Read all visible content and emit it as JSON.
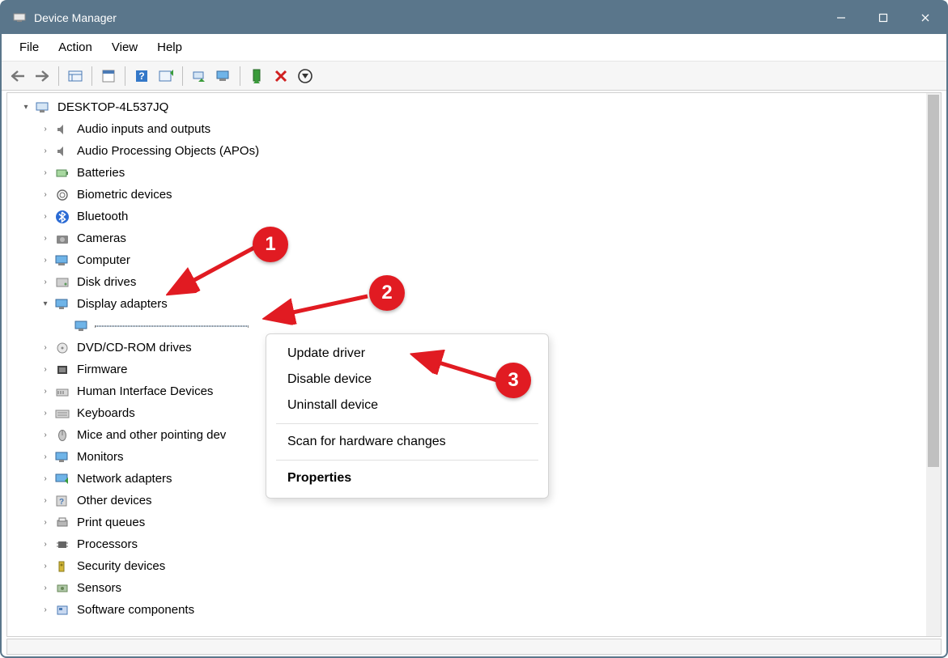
{
  "window": {
    "title": "Device Manager"
  },
  "menubar": [
    "File",
    "Action",
    "View",
    "Help"
  ],
  "toolbar_icons": [
    "back",
    "forward",
    "sep",
    "show-hidden",
    "properties",
    "sep",
    "help",
    "update",
    "sep",
    "scan",
    "monitor",
    "sep",
    "enable",
    "disable",
    "sep",
    "uninstall"
  ],
  "root_node": "DESKTOP-4L537JQ",
  "categories": [
    {
      "label": "Audio inputs and outputs",
      "icon": "audio"
    },
    {
      "label": "Audio Processing Objects (APOs)",
      "icon": "audio"
    },
    {
      "label": "Batteries",
      "icon": "battery"
    },
    {
      "label": "Biometric devices",
      "icon": "biometric"
    },
    {
      "label": "Bluetooth",
      "icon": "bluetooth"
    },
    {
      "label": "Cameras",
      "icon": "camera"
    },
    {
      "label": "Computer",
      "icon": "computer"
    },
    {
      "label": "Disk drives",
      "icon": "disk"
    },
    {
      "label": "Display adapters",
      "icon": "display",
      "expanded": true,
      "children": [
        {
          "label": " ",
          "icon": "display",
          "selected": true
        }
      ]
    },
    {
      "label": "DVD/CD-ROM drives",
      "icon": "dvd"
    },
    {
      "label": "Firmware",
      "icon": "firmware"
    },
    {
      "label": "Human Interface Devices",
      "icon": "hid"
    },
    {
      "label": "Keyboards",
      "icon": "keyboard"
    },
    {
      "label": "Mice and other pointing dev",
      "icon": "mouse"
    },
    {
      "label": "Monitors",
      "icon": "monitor"
    },
    {
      "label": "Network adapters",
      "icon": "network"
    },
    {
      "label": "Other devices",
      "icon": "other"
    },
    {
      "label": "Print queues",
      "icon": "printer"
    },
    {
      "label": "Processors",
      "icon": "cpu"
    },
    {
      "label": "Security devices",
      "icon": "security"
    },
    {
      "label": "Sensors",
      "icon": "sensor"
    },
    {
      "label": "Software components",
      "icon": "software"
    }
  ],
  "context_menu": {
    "items": [
      {
        "label": "Update driver"
      },
      {
        "label": "Disable device"
      },
      {
        "label": "Uninstall device"
      },
      {
        "sep": true
      },
      {
        "label": "Scan for hardware changes"
      },
      {
        "sep": true
      },
      {
        "label": "Properties",
        "bold": true
      }
    ]
  },
  "annotations": {
    "badges": [
      "1",
      "2",
      "3"
    ]
  }
}
